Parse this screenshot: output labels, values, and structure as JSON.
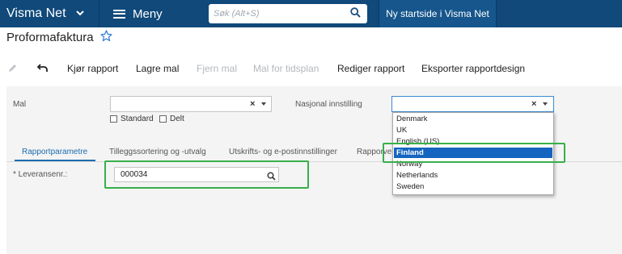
{
  "topbar": {
    "brand": "Visma Net",
    "menu_label": "Meny",
    "search_placeholder": "Søk (Alt+S)",
    "active_tab": "Ny startside i Visma Net"
  },
  "page": {
    "title": "Proformafaktura"
  },
  "toolbar": {
    "run_report": "Kjør rapport",
    "save_template": "Lagre mal",
    "remove_template": "Fjern mal",
    "schedule_template": "Mal for tidsplan",
    "edit_report": "Rediger rapport",
    "export_design": "Eksporter rapportdesign"
  },
  "filters": {
    "template_label": "Mal",
    "template_value": "",
    "standard_label": "Standard",
    "shared_label": "Delt",
    "national_label": "Nasjonal innstilling",
    "national_value": ""
  },
  "tabs": [
    "Rapportparametre",
    "Tilleggssortering og -utvalg",
    "Utskrifts- og e-postinnstillinger",
    "Rapporve"
  ],
  "fields": {
    "delivery_label": "* Leveransenr.:",
    "delivery_value": "000034"
  },
  "dropdown": {
    "options": [
      "Denmark",
      "UK",
      "English (US)",
      "Finland",
      "Norway",
      "Netherlands",
      "Sweden"
    ],
    "selected": "Finland"
  },
  "colors": {
    "topbar": "#10497a",
    "selected_option": "#1565c0",
    "highlight": "#37b04a",
    "active_tab": "#1b6cae"
  }
}
